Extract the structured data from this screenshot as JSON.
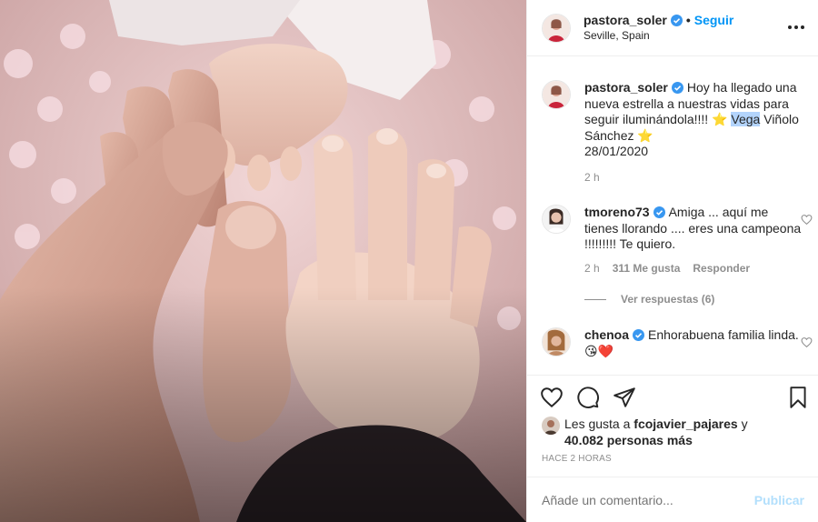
{
  "post": {
    "author": "pastora_soler",
    "follow_label": "Seguir",
    "location": "Seville, Spain",
    "dot": "•",
    "photo_description_icon": "baby-hands-photo"
  },
  "comments": [
    {
      "username": "pastora_soler",
      "text_before": "Hoy ha llegado una nueva estrella a nuestras vidas para seguir iluminándola!!!! ⭐ ",
      "highlight": "Vega",
      "text_after": " Viñolo Sánchez ⭐",
      "date": "28/01/2020",
      "time": "2 h"
    },
    {
      "username": "tmoreno73",
      "text": "Amiga ... aquí me tienes llorando .... eres una campeona !!!!!!!!! Te quiero.",
      "time": "2 h",
      "likes": "311 Me gusta",
      "reply": "Responder"
    },
    {
      "username": "chenoa",
      "text": "Enhorabuena familia linda.😘❤️"
    }
  ],
  "replies_label": "Ver respuestas (6)",
  "likes": {
    "prefix": "Les gusta a ",
    "user": "fcojavier_pajares",
    "middle": " y",
    "count": "40.082 personas más"
  },
  "time_ago": "HACE 2 HORAS",
  "comment_box": {
    "placeholder": "Añade un comentario...",
    "publish": "Publicar"
  },
  "colors": {
    "accent": "#0095f6",
    "publish_disabled": "#b2dffc",
    "muted": "#8e8e8e",
    "verified": "#3897f0"
  }
}
